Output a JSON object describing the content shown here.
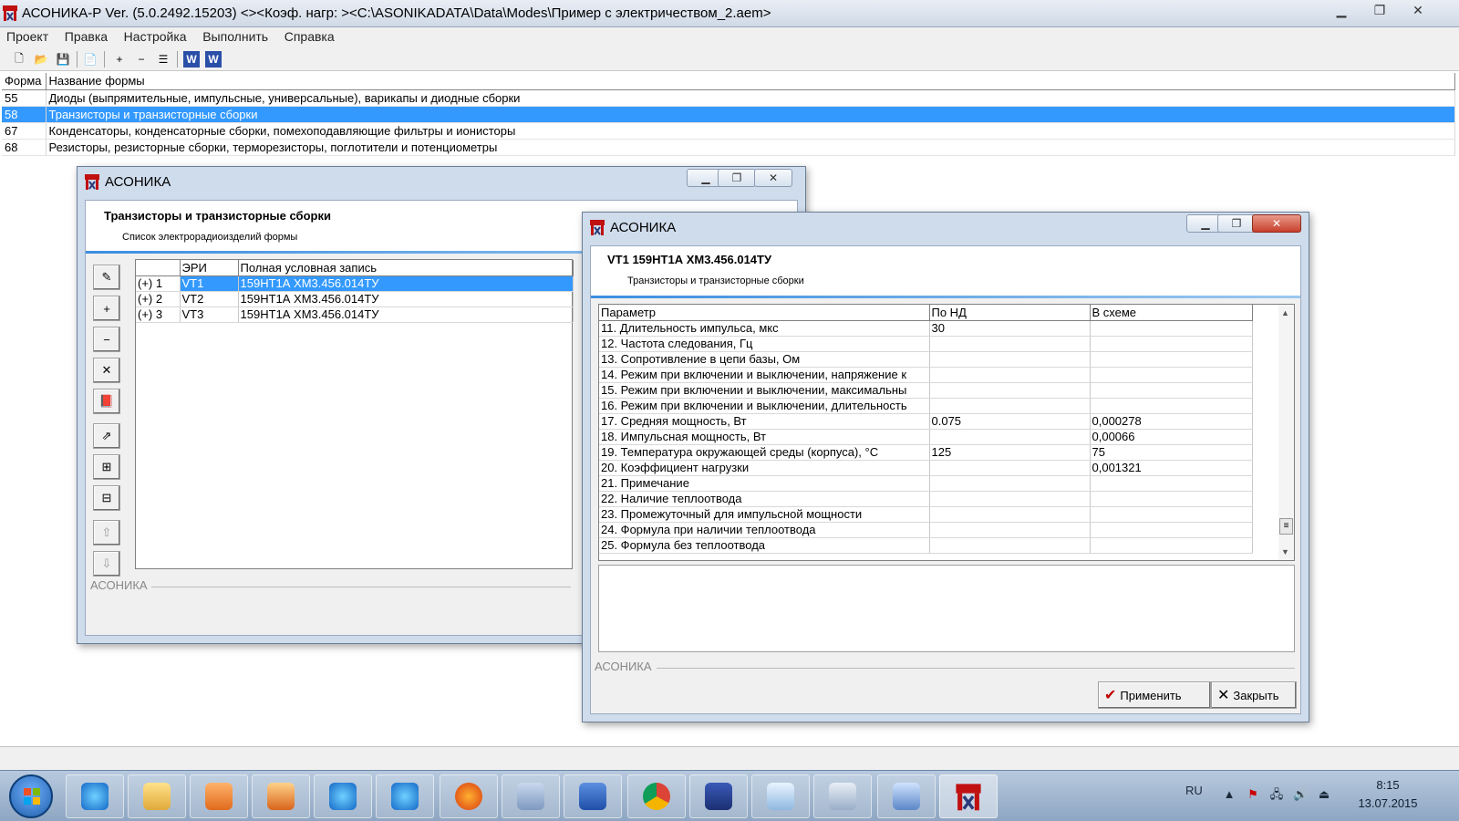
{
  "main": {
    "title": "АСОНИКА-Р  Ver. (5.0.2492.15203) <><Коэф. нагр: ><C:\\ASONIKADATA\\Data\\Modes\\Пример с электричеством_2.aem>",
    "menu": [
      "Проект",
      "Правка",
      "Настройка",
      "Выполнить",
      "Справка"
    ],
    "grid": {
      "headers": [
        "Форма",
        "Название формы"
      ],
      "rows": [
        {
          "code": "55",
          "name": "Диоды (выпрямительные, импульсные, универсальные), варикапы и диодные сборки"
        },
        {
          "code": "58",
          "name": "Транзисторы и транзисторные сборки"
        },
        {
          "code": "67",
          "name": "Конденсаторы, конденсаторные сборки, помехоподавляющие фильтры и ионисторы"
        },
        {
          "code": "68",
          "name": "Резисторы, резисторные сборки, терморезисторы, поглотители и потенциометры"
        }
      ]
    }
  },
  "dialog1": {
    "title": "АСОНИКА",
    "heading": "Транзисторы и транзисторные сборки",
    "subheading": "Список электрорадиоизделий формы",
    "headers": [
      "",
      "ЭРИ",
      "Полная условная запись"
    ],
    "rows": [
      {
        "num": "(+) 1",
        "eri": "VT1",
        "record": "159НТ1А ХМ3.456.014ТУ"
      },
      {
        "num": "(+) 2",
        "eri": "VT2",
        "record": "159НТ1А ХМ3.456.014ТУ"
      },
      {
        "num": "(+) 3",
        "eri": "VT3",
        "record": "159НТ1А ХМ3.456.014ТУ"
      }
    ],
    "caption": "АСОНИКА"
  },
  "dialog2": {
    "title": "АСОНИКА",
    "heading": "VT1 159НТ1А ХМ3.456.014ТУ",
    "subheading": "Транзисторы и транзисторные сборки",
    "headers": [
      "Параметр",
      "По НД",
      "В схеме"
    ],
    "rows": [
      {
        "param": "11. Длительность импульса, мкс",
        "nd": "30",
        "scheme": ""
      },
      {
        "param": "12. Частота следования, Гц",
        "nd": "",
        "scheme": ""
      },
      {
        "param": "13. Сопротивление в цепи базы, Ом",
        "nd": "",
        "scheme": ""
      },
      {
        "param": "14. Режим при включении и выключении, напряжение к",
        "nd": "",
        "scheme": ""
      },
      {
        "param": "15. Режим при включении и выключении, максимальны",
        "nd": "",
        "scheme": ""
      },
      {
        "param": "16. Режим при включении и выключении, длительность",
        "nd": "",
        "scheme": ""
      },
      {
        "param": "17. Средняя мощность, Вт",
        "nd": "0.075",
        "scheme": "0,000278"
      },
      {
        "param": "18. Импульсная мощность, Вт",
        "nd": "",
        "scheme": "0,00066"
      },
      {
        "param": "19. Температура окружающей среды (корпуса), °С",
        "nd": "125",
        "scheme": "75"
      },
      {
        "param": "20. Коэффициент нагрузки",
        "nd": "",
        "scheme": "0,001321"
      },
      {
        "param": "21. Примечание",
        "nd": "",
        "scheme": ""
      },
      {
        "param": "22. Наличие теплоотвода",
        "nd": "",
        "scheme": ""
      },
      {
        "param": "23. Промежуточный для импульсной мощности",
        "nd": "",
        "scheme": ""
      },
      {
        "param": "24. Формула при наличии теплоотвода",
        "nd": "",
        "scheme": ""
      },
      {
        "param": "25. Формула без теплоотвода",
        "nd": "",
        "scheme": ""
      }
    ],
    "caption": "АСОНИКА",
    "apply_label": "Применить",
    "close_label": "Закрыть"
  },
  "taskbar": {
    "lang": "RU",
    "time": "8:15",
    "date": "13.07.2015",
    "apps": [
      "internet-explorer-icon",
      "folder-icon",
      "media-player-icon",
      "asonika-icon",
      "internet-explorer-icon",
      "internet-explorer-icon",
      "firefox-icon",
      "speaker-app-icon",
      "word-icon",
      "chrome-icon",
      "floppy-icon",
      "notepad-icon",
      "calculator-icon",
      "control-panel-icon",
      "asonika-app-icon"
    ]
  },
  "colors": {
    "selection": "#3399ff",
    "accent": "#3c8ee0",
    "apply_check": "#c00000"
  }
}
